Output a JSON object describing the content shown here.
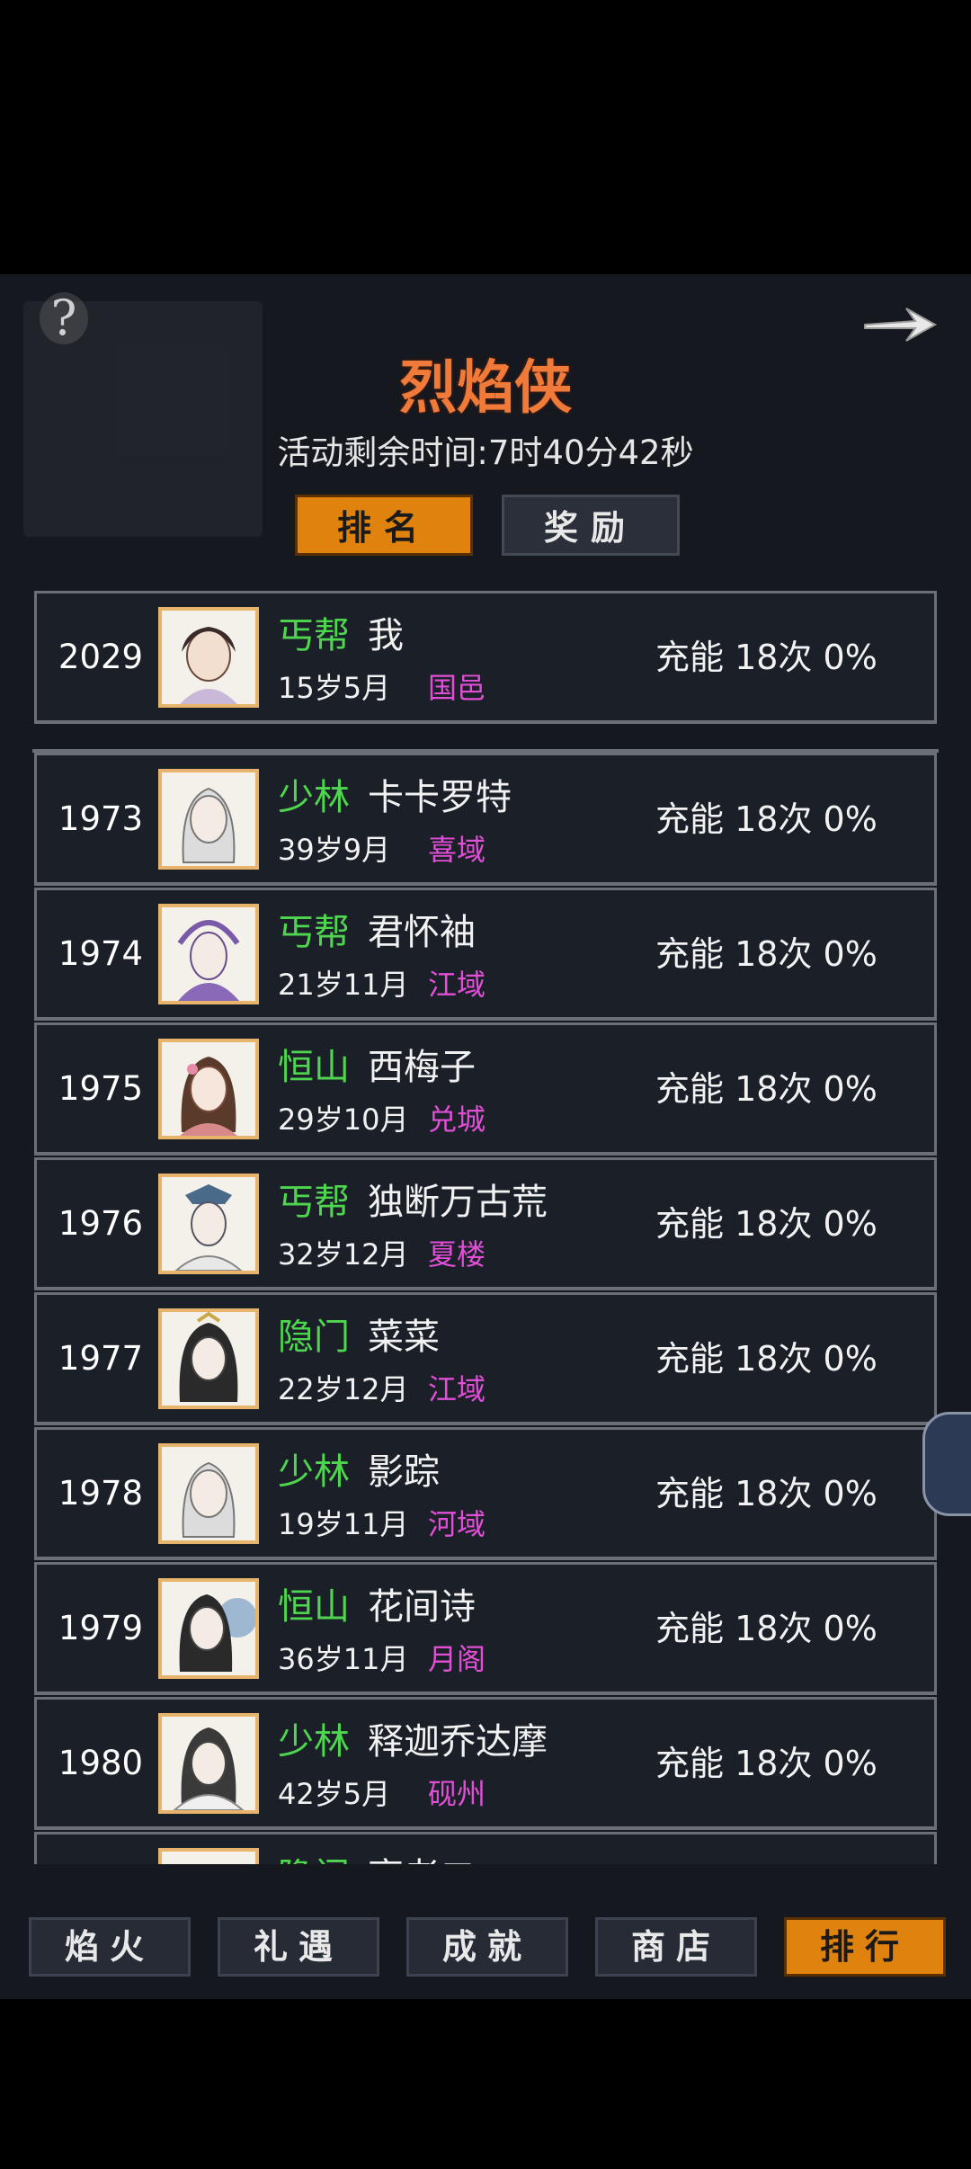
{
  "title": "烈焰侠",
  "timer_text": "活动剩余时间:7时40分42秒",
  "tabs": {
    "rank": "排名",
    "reward": "奖励"
  },
  "my_row": {
    "rank": "2029",
    "sect": "丐帮",
    "name": "我",
    "age": "15岁5月",
    "region": "国邑",
    "charge": "充能 18次 0%"
  },
  "rows": [
    {
      "rank": "1973",
      "sect": "少林",
      "name": "卡卡罗特",
      "age": "39岁9月",
      "region": "喜域",
      "charge": "充能 18次 0%"
    },
    {
      "rank": "1974",
      "sect": "丐帮",
      "name": "君怀袖",
      "age": "21岁11月",
      "region": "江域",
      "charge": "充能 18次 0%"
    },
    {
      "rank": "1975",
      "sect": "恒山",
      "name": "西梅子",
      "age": "29岁10月",
      "region": "兑城",
      "charge": "充能 18次 0%"
    },
    {
      "rank": "1976",
      "sect": "丐帮",
      "name": "独断万古荒",
      "age": "32岁12月",
      "region": "夏楼",
      "charge": "充能 18次 0%"
    },
    {
      "rank": "1977",
      "sect": "隐门",
      "name": "菜菜",
      "age": "22岁12月",
      "region": "江域",
      "charge": "充能 18次 0%"
    },
    {
      "rank": "1978",
      "sect": "少林",
      "name": "影踪",
      "age": "19岁11月",
      "region": "河域",
      "charge": "充能 18次 0%"
    },
    {
      "rank": "1979",
      "sect": "恒山",
      "name": "花间诗",
      "age": "36岁11月",
      "region": "月阁",
      "charge": "充能 18次 0%"
    },
    {
      "rank": "1980",
      "sect": "少林",
      "name": "释迦乔达摩",
      "age": "42岁5月",
      "region": "砚州",
      "charge": "充能 18次 0%"
    },
    {
      "rank": "",
      "sect": "隐门",
      "name": "亮老二",
      "age": "",
      "region": "",
      "charge": ""
    }
  ],
  "nav": [
    "焰火",
    "礼遇",
    "成就",
    "商店",
    "排行"
  ],
  "colors": {
    "title": "#f07a3a",
    "sect": "#4fd64f",
    "region": "#e04fd6",
    "active": "#e0820e"
  }
}
